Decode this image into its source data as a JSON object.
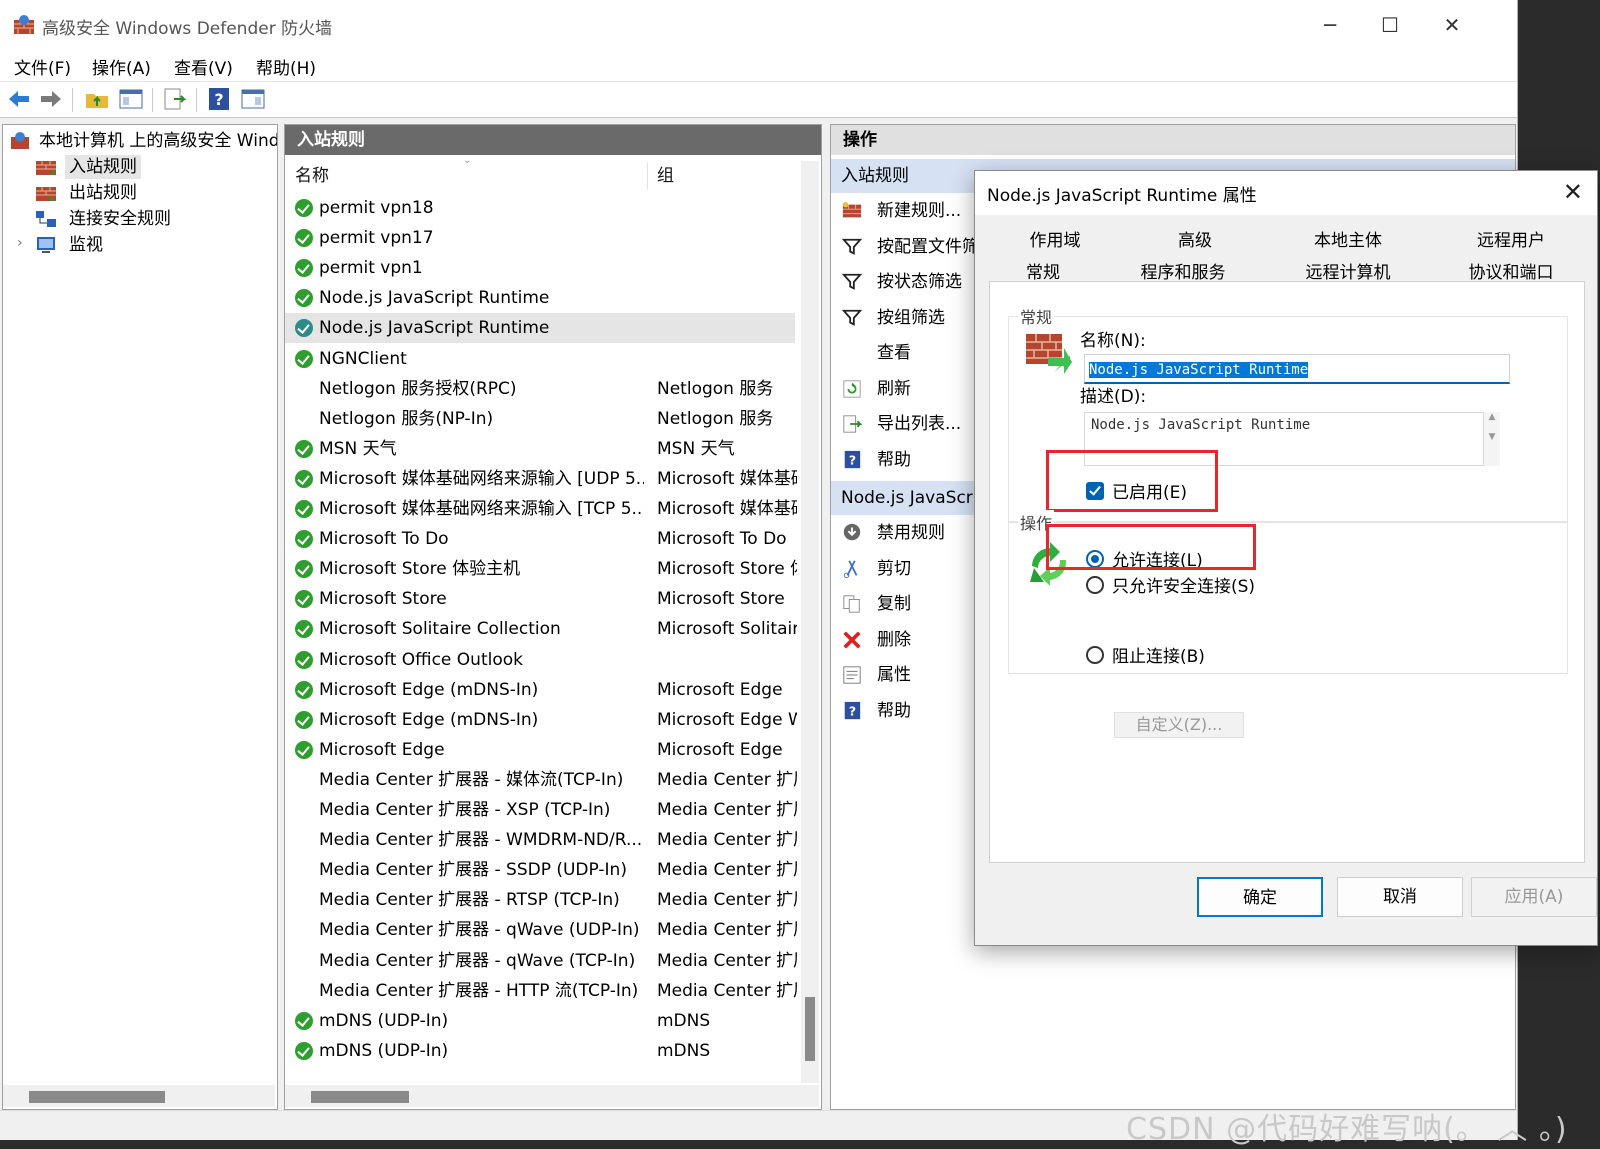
{
  "window": {
    "title": "高级安全 Windows Defender 防火墙"
  },
  "menu": [
    "文件(F)",
    "操作(A)",
    "查看(V)",
    "帮助(H)"
  ],
  "tree": {
    "root": "本地计算机 上的高级安全 Windows Defender 防火墙",
    "items": [
      "入站规则",
      "出站规则",
      "连接安全规则",
      "监视"
    ]
  },
  "list": {
    "header": "入站规则",
    "columns": [
      "名称",
      "组"
    ],
    "rows": [
      {
        "name": "permit vpn18",
        "group": "",
        "icon": true
      },
      {
        "name": "permit vpn17",
        "group": "",
        "icon": true
      },
      {
        "name": "permit vpn1",
        "group": "",
        "icon": true
      },
      {
        "name": "Node.js JavaScript Runtime",
        "group": "",
        "icon": true
      },
      {
        "name": "Node.js JavaScript Runtime",
        "group": "",
        "icon": true
      },
      {
        "name": "NGNClient",
        "group": "",
        "icon": true
      },
      {
        "name": "Netlogon 服务授权(RPC)",
        "group": "Netlogon 服务",
        "icon": false
      },
      {
        "name": "Netlogon 服务(NP-In)",
        "group": "Netlogon 服务",
        "icon": false
      },
      {
        "name": "MSN 天气",
        "group": "MSN 天气",
        "icon": true
      },
      {
        "name": "Microsoft 媒体基础网络来源输入 [UDP 5...",
        "group": "Microsoft 媒体基础",
        "icon": true
      },
      {
        "name": "Microsoft 媒体基础网络来源输入 [TCP 5...",
        "group": "Microsoft 媒体基础",
        "icon": true
      },
      {
        "name": "Microsoft To Do",
        "group": "Microsoft To Do",
        "icon": true
      },
      {
        "name": "Microsoft Store 体验主机",
        "group": "Microsoft Store 体",
        "icon": true
      },
      {
        "name": "Microsoft Store",
        "group": "Microsoft Store",
        "icon": true
      },
      {
        "name": "Microsoft Solitaire Collection",
        "group": "Microsoft Solitaire",
        "icon": true
      },
      {
        "name": "Microsoft Office Outlook",
        "group": "",
        "icon": true
      },
      {
        "name": "Microsoft Edge (mDNS-In)",
        "group": "Microsoft Edge",
        "icon": true
      },
      {
        "name": "Microsoft Edge (mDNS-In)",
        "group": "Microsoft Edge W",
        "icon": true
      },
      {
        "name": "Microsoft Edge",
        "group": "Microsoft Edge",
        "icon": true
      },
      {
        "name": "Media Center 扩展器 - 媒体流(TCP-In)",
        "group": "Media Center 扩展",
        "icon": false
      },
      {
        "name": "Media Center 扩展器 - XSP (TCP-In)",
        "group": "Media Center 扩展",
        "icon": false
      },
      {
        "name": "Media Center 扩展器 - WMDRM-ND/R...",
        "group": "Media Center 扩展",
        "icon": false
      },
      {
        "name": "Media Center 扩展器 - SSDP (UDP-In)",
        "group": "Media Center 扩展",
        "icon": false
      },
      {
        "name": "Media Center 扩展器 - RTSP (TCP-In)",
        "group": "Media Center 扩展",
        "icon": false
      },
      {
        "name": "Media Center 扩展器 - qWave (UDP-In)",
        "group": "Media Center 扩展",
        "icon": false
      },
      {
        "name": "Media Center 扩展器 - qWave (TCP-In)",
        "group": "Media Center 扩展",
        "icon": false
      },
      {
        "name": "Media Center 扩展器 - HTTP 流(TCP-In)",
        "group": "Media Center 扩展",
        "icon": false
      },
      {
        "name": "mDNS (UDP-In)",
        "group": "mDNS",
        "icon": true
      },
      {
        "name": "mDNS (UDP-In)",
        "group": "mDNS",
        "icon": true
      }
    ]
  },
  "actions": {
    "header": "操作",
    "section1": "入站规则",
    "items1": [
      "新建规则...",
      "按配置文件筛选",
      "按状态筛选",
      "按组筛选",
      "查看",
      "刷新",
      "导出列表...",
      "帮助"
    ],
    "section2": "Node.js JavaScript Runtime",
    "items2": [
      "禁用规则",
      "剪切",
      "复制",
      "删除",
      "属性",
      "帮助"
    ]
  },
  "dialog": {
    "title": "Node.js JavaScript Runtime 属性",
    "tabs_row1": [
      "作用域",
      "高级",
      "本地主体",
      "远程用户"
    ],
    "tabs_row2": [
      "常规",
      "程序和服务",
      "远程计算机",
      "协议和端口"
    ],
    "group_general": "常规",
    "name_label": "名称(N):",
    "name_value": "Node.js JavaScript Runtime",
    "desc_label": "描述(D):",
    "desc_value": "Node.js JavaScript Runtime",
    "enabled_label": "已启用(E)",
    "group_action": "操作",
    "opt_allow": "允许连接(L)",
    "opt_secure": "只允许安全连接(S)",
    "custom_btn": "自定义(Z)...",
    "opt_block": "阻止连接(B)",
    "btn_ok": "确定",
    "btn_cancel": "取消",
    "btn_apply": "应用(A)"
  },
  "watermark": "CSDN @代码好难写呐(。  ︿ 。)"
}
